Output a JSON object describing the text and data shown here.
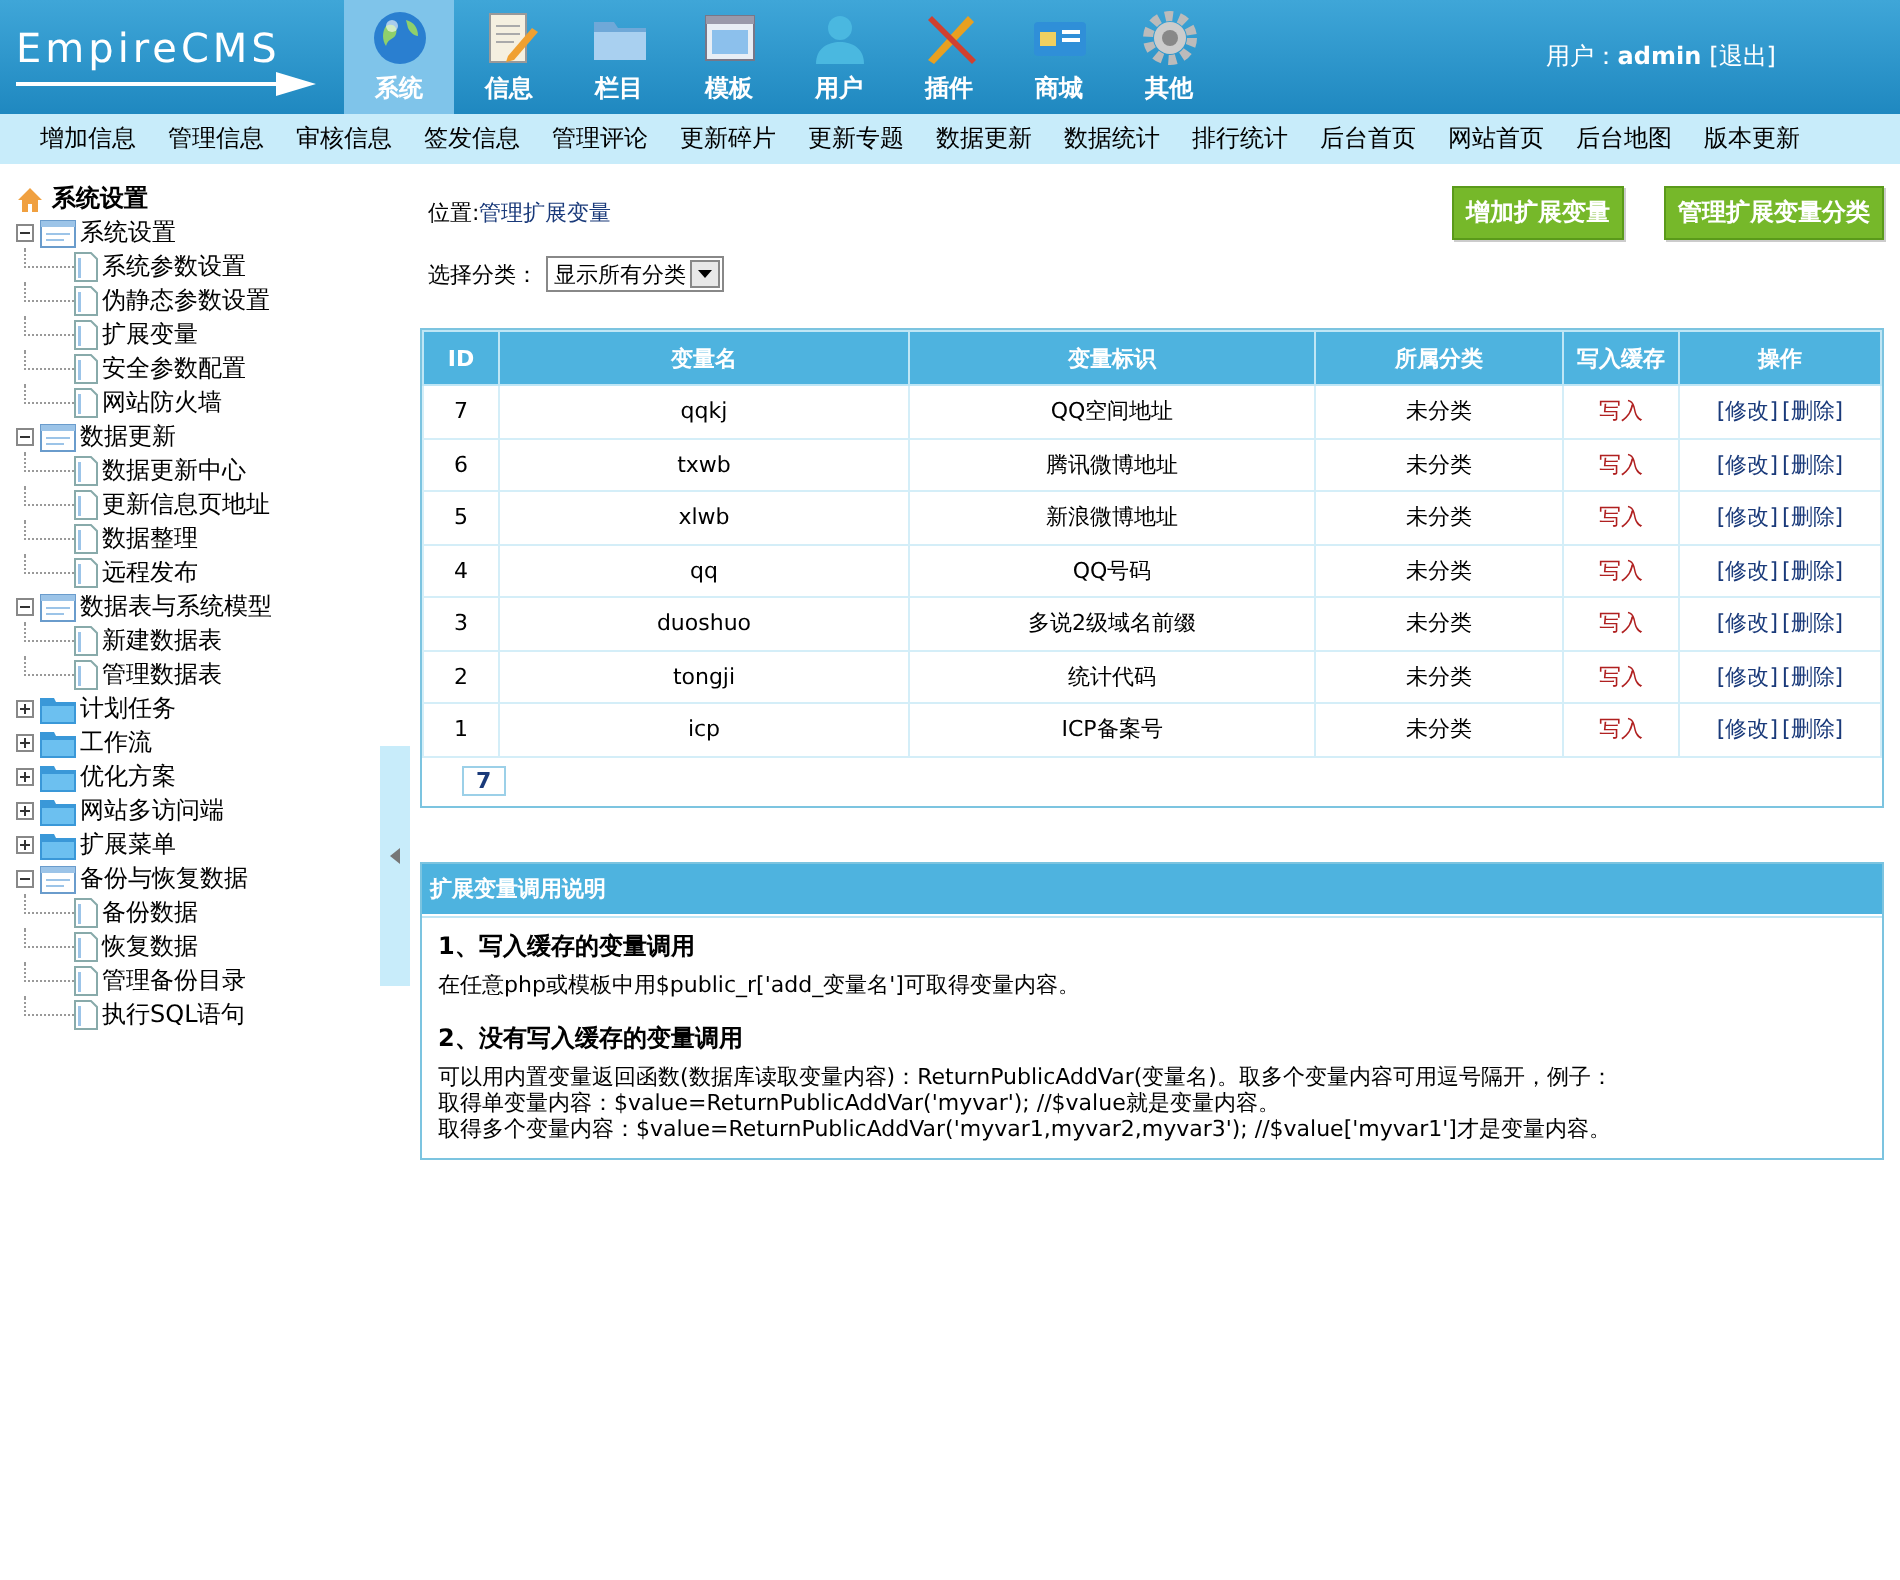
{
  "header": {
    "logo": "EmpireCMS",
    "nav": [
      {
        "label": "系统",
        "selected": true
      },
      {
        "label": "信息",
        "selected": false
      },
      {
        "label": "栏目",
        "selected": false
      },
      {
        "label": "模板",
        "selected": false
      },
      {
        "label": "用户",
        "selected": false
      },
      {
        "label": "插件",
        "selected": false
      },
      {
        "label": "商城",
        "selected": false
      },
      {
        "label": "其他",
        "selected": false
      }
    ],
    "user_label": "用户：",
    "user": "admin",
    "logout": "[退出]"
  },
  "menu": [
    "增加信息",
    "管理信息",
    "审核信息",
    "签发信息",
    "管理评论",
    "更新碎片",
    "更新专题",
    "数据更新",
    "数据统计",
    "排行统计",
    "后台首页",
    "网站首页",
    "后台地图",
    "版本更新"
  ],
  "sidebar": {
    "root": "系统设置",
    "groups": [
      {
        "label": "系统设置",
        "expanded": true,
        "children": [
          {
            "label": "系统参数设置"
          },
          {
            "label": "伪静态参数设置"
          },
          {
            "label": "扩展变量"
          },
          {
            "label": "安全参数配置"
          },
          {
            "label": "网站防火墙"
          }
        ]
      },
      {
        "label": "数据更新",
        "expanded": true,
        "children": [
          {
            "label": "数据更新中心"
          },
          {
            "label": "更新信息页地址"
          },
          {
            "label": "数据整理"
          },
          {
            "label": "远程发布"
          }
        ]
      },
      {
        "label": "数据表与系统模型",
        "expanded": true,
        "children": [
          {
            "label": "新建数据表"
          },
          {
            "label": "管理数据表"
          }
        ]
      },
      {
        "label": "计划任务",
        "expanded": false
      },
      {
        "label": "工作流",
        "expanded": false
      },
      {
        "label": "优化方案",
        "expanded": false
      },
      {
        "label": "网站多访问端",
        "expanded": false
      },
      {
        "label": "扩展菜单",
        "expanded": false
      },
      {
        "label": "备份与恢复数据",
        "expanded": true,
        "children": [
          {
            "label": "备份数据"
          },
          {
            "label": "恢复数据"
          },
          {
            "label": "管理备份目录"
          },
          {
            "label": "执行SQL语句"
          }
        ]
      }
    ]
  },
  "content": {
    "location_label": "位置:",
    "location": "管理扩展变量",
    "buttons": [
      "增加扩展变量",
      "管理扩展变量分类"
    ],
    "filter_label": "选择分类：",
    "filter_value": "显示所有分类",
    "table": {
      "columns": [
        "ID",
        "变量名",
        "变量标识",
        "所属分类",
        "写入缓存",
        "操作"
      ],
      "rows": [
        [
          "7",
          "qqkj",
          "QQ空间地址",
          "未分类",
          "写入",
          [
            "[修改]",
            "[删除]"
          ]
        ],
        [
          "6",
          "txwb",
          "腾讯微博地址",
          "未分类",
          "写入",
          [
            "[修改]",
            "[删除]"
          ]
        ],
        [
          "5",
          "xlwb",
          "新浪微博地址",
          "未分类",
          "写入",
          [
            "[修改]",
            "[删除]"
          ]
        ],
        [
          "4",
          "qq",
          "QQ号码",
          "未分类",
          "写入",
          [
            "[修改]",
            "[删除]"
          ]
        ],
        [
          "3",
          "duoshuo",
          "多说2级域名前缀",
          "未分类",
          "写入",
          [
            "[修改]",
            "[删除]"
          ]
        ],
        [
          "2",
          "tongji",
          "统计代码",
          "未分类",
          "写入",
          [
            "[修改]",
            "[删除]"
          ]
        ],
        [
          "1",
          "icp",
          "ICP备案号",
          "未分类",
          "写入",
          [
            "[修改]",
            "[删除]"
          ]
        ]
      ],
      "pager": "7"
    },
    "help": {
      "title": "扩展变量调用说明",
      "sections": [
        {
          "heading": "1、写入缓存的变量调用",
          "lines": [
            "在任意php或模板中用$public_r['add_变量名']可取得变量内容。"
          ]
        },
        {
          "heading": "2、没有写入缓存的变量调用",
          "lines": [
            "可以用内置变量返回函数(数据库读取变量内容)：ReturnPublicAddVar(变量名)。取多个变量内容可用逗号隔开，例子：",
            "取得单变量内容：$value=ReturnPublicAddVar('myvar'); //$value就是变量内容。",
            "取得多个变量内容：$value=ReturnPublicAddVar('myvar1,myvar2,myvar3'); //$value['myvar1']才是变量内容。"
          ]
        }
      ]
    }
  }
}
